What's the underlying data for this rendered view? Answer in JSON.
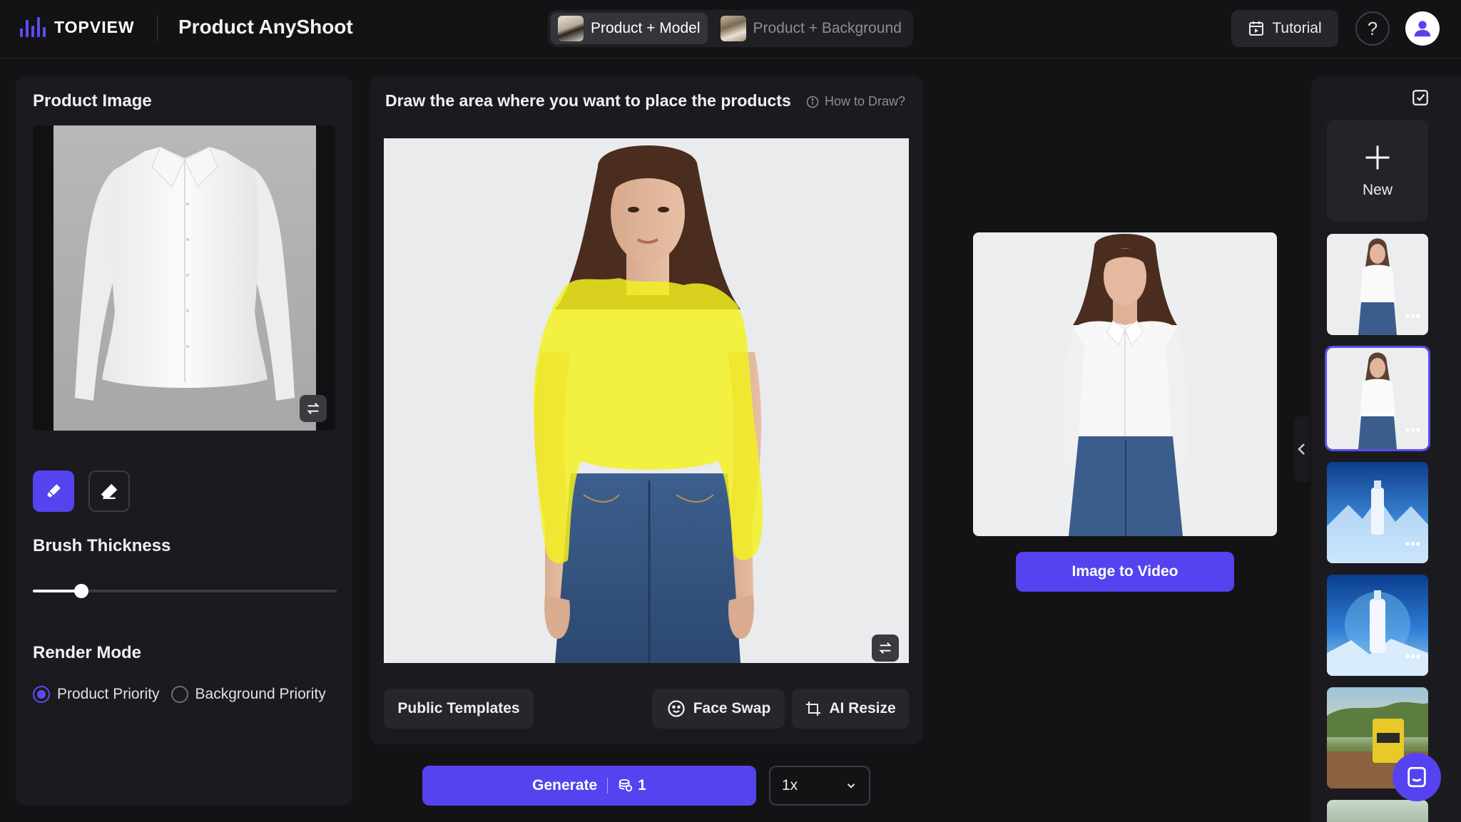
{
  "header": {
    "brand": "TOPVIEW",
    "app_title": "Product AnyShoot",
    "tabs": [
      {
        "label": "Product + Model",
        "active": true
      },
      {
        "label": "Product + Background",
        "active": false
      }
    ],
    "tutorial_label": "Tutorial",
    "help_label": "?"
  },
  "left": {
    "product_image_title": "Product Image",
    "brush_thickness_title": "Brush Thickness",
    "brush_thickness_fraction": 0.16,
    "render_mode_title": "Render Mode",
    "render_options": [
      {
        "label": "Product Priority",
        "selected": true
      },
      {
        "label": "Background Priority",
        "selected": false
      }
    ]
  },
  "center": {
    "draw_title": "Draw the area where you want to place the products",
    "how_to": "How to Draw?",
    "public_templates": "Public Templates",
    "face_swap": "Face Swap",
    "ai_resize": "AI Resize",
    "generate_label": "Generate",
    "generate_cost": "1",
    "quantity": "1x"
  },
  "result": {
    "image_to_video": "Image to Video"
  },
  "rail": {
    "new_label": "New",
    "more_label": "•••"
  },
  "colors": {
    "accent": "#5543f0",
    "panel": "#1b1b1f",
    "background": "#131316",
    "mask": "#f3f11f"
  }
}
